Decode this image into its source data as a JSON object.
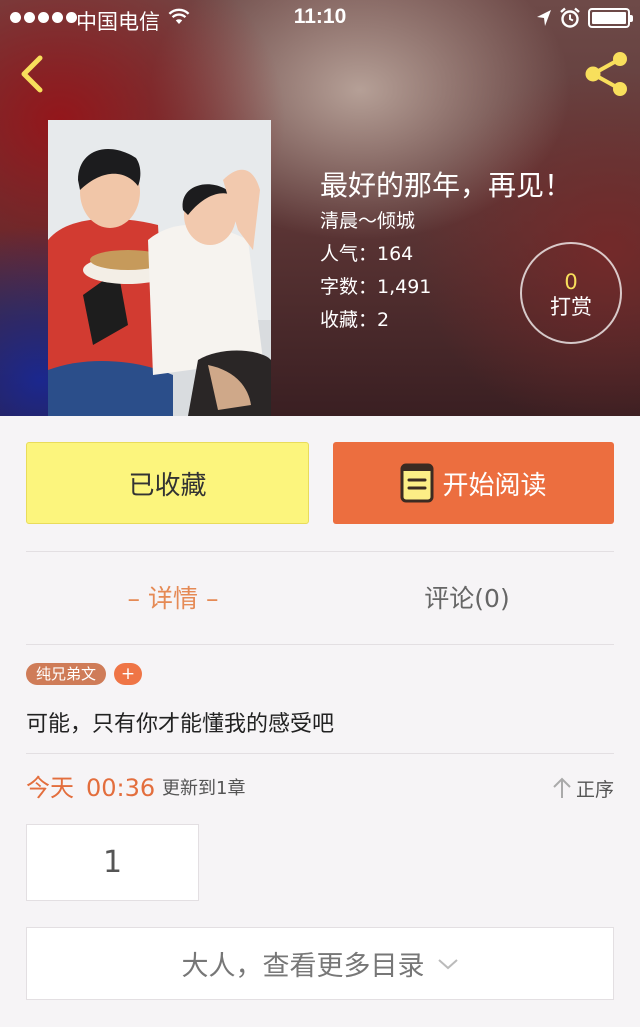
{
  "status_bar": {
    "carrier": "中国电信",
    "time": "11:10"
  },
  "header": {
    "back_icon": "chevron-left-icon",
    "share_icon": "share-icon",
    "icon_color": "#f8df5c"
  },
  "book": {
    "title": "最好的那年，再见！",
    "author": "清晨～倾城",
    "popularity": "人气：164",
    "word_count": "字数：1,491",
    "favorites": "收藏：2",
    "tip_count": "0",
    "tip_label": "打赏"
  },
  "actions": {
    "collect_label": "已收藏",
    "read_label": "开始阅读",
    "collect_color": "#fcf57d",
    "read_color": "#ec6e3f"
  },
  "tabs": [
    {
      "label": "– 详情 –",
      "active": true
    },
    {
      "label": "评论(0)",
      "active": false
    }
  ],
  "tags": [
    "纯兄弟文"
  ],
  "tag_add_label": "+",
  "description": "可能，只有你才能懂我的感受吧",
  "update": {
    "day": "今天",
    "time": "00:36",
    "text": "更新到1章",
    "sort_label": "正序"
  },
  "chapters": [
    "1"
  ],
  "more_label": "大人，查看更多目录"
}
